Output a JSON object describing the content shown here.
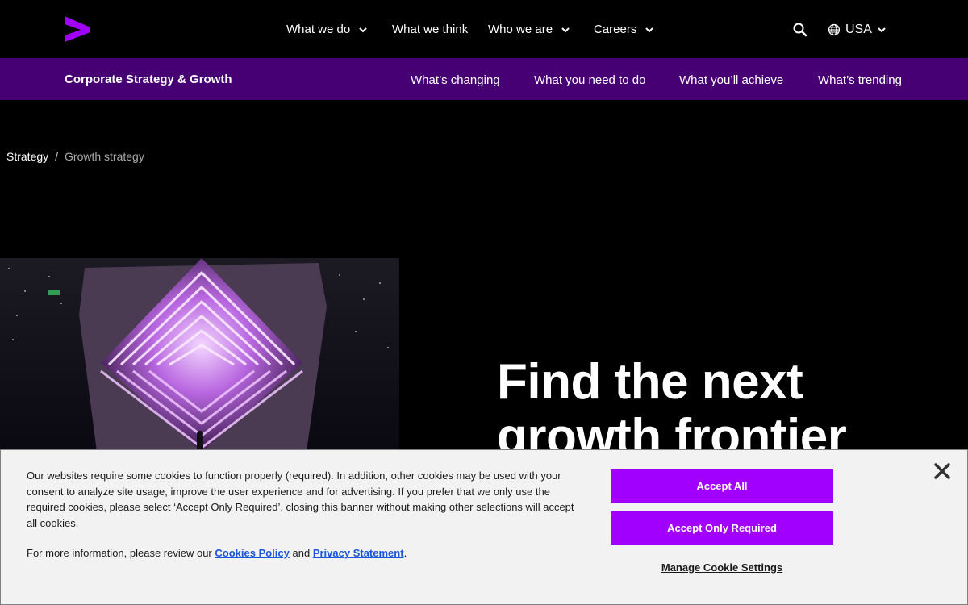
{
  "header": {
    "nav": [
      {
        "label": "What we do",
        "has_menu": true
      },
      {
        "label": "What we think",
        "has_menu": false
      },
      {
        "label": "Who we are",
        "has_menu": true
      },
      {
        "label": "Careers",
        "has_menu": true
      }
    ],
    "country": "USA"
  },
  "subnav": {
    "title": "Corporate Strategy & Growth",
    "links": [
      "What’s changing",
      "What you need to do",
      "What you’ll achieve",
      "What’s trending"
    ]
  },
  "breadcrumb": {
    "parent": "Strategy",
    "separator": "/",
    "current": "Growth strategy"
  },
  "hero": {
    "title_line1": "Find the next",
    "title_line2": "growth frontier"
  },
  "cookie_banner": {
    "text": "Our websites require some cookies to function properly (required). In addition, other cookies may be used with your consent to analyze site usage, improve the user experience and for advertising. If you prefer that we only use the required cookies, please select ‘Accept Only Required’, closing this banner without making other selections will accept all cookies.",
    "more_prefix": "For more information, please review our",
    "cookies_policy": "Cookies Policy",
    "and": "and",
    "privacy_statement": "Privacy Statement",
    "period": ".",
    "accept_all": "Accept All",
    "accept_required": "Accept Only Required",
    "manage": "Manage Cookie Settings"
  },
  "colors": {
    "brand_purple": "#a100ff",
    "subnav_bg": "#460073",
    "link_blue": "#1a56db"
  }
}
